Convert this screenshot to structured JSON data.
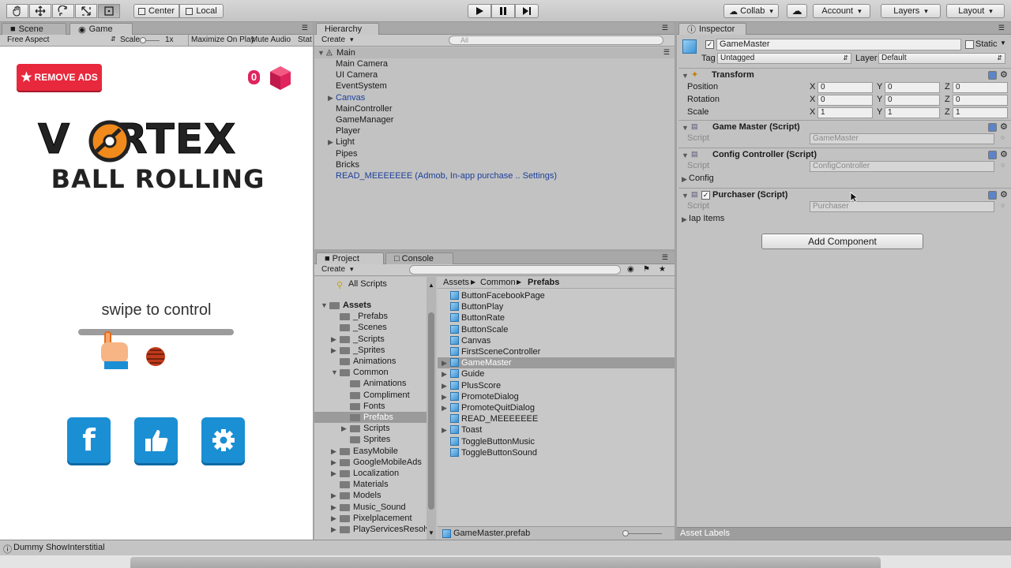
{
  "toolbar": {
    "tools": [
      "hand-icon",
      "move-icon",
      "rotate-icon",
      "scale-icon",
      "rect-icon"
    ],
    "pivot": "Center",
    "space": "Local",
    "collab": "Collab",
    "account": "Account",
    "layers": "Layers",
    "layout": "Layout"
  },
  "game_view": {
    "tabs": [
      "Scene",
      "Game"
    ],
    "aspect": "Free Aspect",
    "scale_label": "Scale",
    "scale_value": "1x",
    "maximize": "Maximize On Play",
    "mute": "Mute Audio",
    "stats": "Stats",
    "remove_ads": "REMOVE ADS",
    "gem_count": "0",
    "logo_line1": "V   RTEX",
    "logo_line2": "BALL ROLLING",
    "swipe": "swipe to control",
    "buttons": [
      "facebook-icon",
      "thumbs-up-icon",
      "settings-gear-icon"
    ],
    "brand": {
      "red": "#e8283c",
      "blue": "#1a8fd4",
      "gem": "#e0245e"
    }
  },
  "hierarchy": {
    "tab": "Hierarchy",
    "create": "Create",
    "search": "All",
    "scene": "Main",
    "items": [
      {
        "label": "Main Camera",
        "expand": false,
        "highlight": false
      },
      {
        "label": "UI Camera",
        "expand": false,
        "highlight": false
      },
      {
        "label": "EventSystem",
        "expand": false,
        "highlight": false
      },
      {
        "label": "Canvas",
        "expand": true,
        "highlight": true
      },
      {
        "label": "MainController",
        "expand": false,
        "highlight": false
      },
      {
        "label": "GameManager",
        "expand": false,
        "highlight": false
      },
      {
        "label": "Player",
        "expand": false,
        "highlight": false
      },
      {
        "label": "Light",
        "expand": true,
        "highlight": false
      },
      {
        "label": "Pipes",
        "expand": false,
        "highlight": false
      },
      {
        "label": "Bricks",
        "expand": false,
        "highlight": false
      },
      {
        "label": "READ_MEEEEEEE (Admob, In-app purchase .. Settings)",
        "expand": false,
        "highlight": true
      }
    ]
  },
  "project": {
    "tabs": [
      "Project",
      "Console"
    ],
    "create": "Create",
    "favorites": [
      {
        "label": "All Scripts"
      }
    ],
    "tree": [
      {
        "label": "Assets",
        "depth": 0,
        "arrow": "open"
      },
      {
        "label": "_Prefabs",
        "depth": 1,
        "arrow": ""
      },
      {
        "label": "_Scenes",
        "depth": 1,
        "arrow": ""
      },
      {
        "label": "_Scripts",
        "depth": 1,
        "arrow": "closed"
      },
      {
        "label": "_Sprites",
        "depth": 1,
        "arrow": "closed"
      },
      {
        "label": "Animations",
        "depth": 1,
        "arrow": ""
      },
      {
        "label": "Common",
        "depth": 1,
        "arrow": "open"
      },
      {
        "label": "Animations",
        "depth": 2,
        "arrow": ""
      },
      {
        "label": "Compliment",
        "depth": 2,
        "arrow": ""
      },
      {
        "label": "Fonts",
        "depth": 2,
        "arrow": ""
      },
      {
        "label": "Prefabs",
        "depth": 2,
        "arrow": "",
        "selected": true
      },
      {
        "label": "Scripts",
        "depth": 2,
        "arrow": "closed"
      },
      {
        "label": "Sprites",
        "depth": 2,
        "arrow": ""
      },
      {
        "label": "EasyMobile",
        "depth": 1,
        "arrow": "closed"
      },
      {
        "label": "GoogleMobileAds",
        "depth": 1,
        "arrow": "closed"
      },
      {
        "label": "Localization",
        "depth": 1,
        "arrow": "closed"
      },
      {
        "label": "Materials",
        "depth": 1,
        "arrow": ""
      },
      {
        "label": "Models",
        "depth": 1,
        "arrow": "closed"
      },
      {
        "label": "Music_Sound",
        "depth": 1,
        "arrow": "closed"
      },
      {
        "label": "Pixelplacement",
        "depth": 1,
        "arrow": "closed"
      },
      {
        "label": "PlayServicesResolver",
        "depth": 1,
        "arrow": "closed"
      }
    ],
    "breadcrumb": [
      "Assets",
      "Common",
      "Prefabs"
    ],
    "assets": [
      {
        "label": "ButtonFacebookPage",
        "arrow": false,
        "selected": false
      },
      {
        "label": "ButtonPlay",
        "arrow": false,
        "selected": false
      },
      {
        "label": "ButtonRate",
        "arrow": false,
        "selected": false
      },
      {
        "label": "ButtonScale",
        "arrow": false,
        "selected": false
      },
      {
        "label": "Canvas",
        "arrow": false,
        "selected": false
      },
      {
        "label": "FirstSceneController",
        "arrow": false,
        "selected": false
      },
      {
        "label": "GameMaster",
        "arrow": true,
        "selected": true
      },
      {
        "label": "Guide",
        "arrow": true,
        "selected": false
      },
      {
        "label": "PlusScore",
        "arrow": true,
        "selected": false
      },
      {
        "label": "PromoteDialog",
        "arrow": true,
        "selected": false
      },
      {
        "label": "PromoteQuitDialog",
        "arrow": true,
        "selected": false
      },
      {
        "label": "READ_MEEEEEEE",
        "arrow": false,
        "selected": false
      },
      {
        "label": "Toast",
        "arrow": true,
        "selected": false
      },
      {
        "label": "ToggleButtonMusic",
        "arrow": false,
        "selected": false
      },
      {
        "label": "ToggleButtonSound",
        "arrow": false,
        "selected": false
      }
    ],
    "footer": "GameMaster.prefab"
  },
  "inspector": {
    "tab": "Inspector",
    "object_name": "GameMaster",
    "static": "Static",
    "tag_label": "Tag",
    "tag": "Untagged",
    "layer_label": "Layer",
    "layer": "Default",
    "transform": {
      "title": "Transform",
      "rows": [
        {
          "label": "Position",
          "x": "0",
          "y": "0",
          "z": "0"
        },
        {
          "label": "Rotation",
          "x": "0",
          "y": "0",
          "z": "0"
        },
        {
          "label": "Scale",
          "x": "1",
          "y": "1",
          "z": "1"
        }
      ]
    },
    "components": [
      {
        "title": "Game Master (Script)",
        "script": "GameMaster",
        "checkbox": false
      },
      {
        "title": "Config Controller (Script)",
        "script": "ConfigController",
        "checkbox": false,
        "extra": "Config"
      },
      {
        "title": "Purchaser (Script)",
        "script": "Purchaser",
        "checkbox": true,
        "extra": "Iap Items"
      }
    ],
    "script_label": "Script",
    "add_component": "Add Component",
    "asset_labels": "Asset Labels"
  },
  "status": "Dummy ShowInterstitial"
}
